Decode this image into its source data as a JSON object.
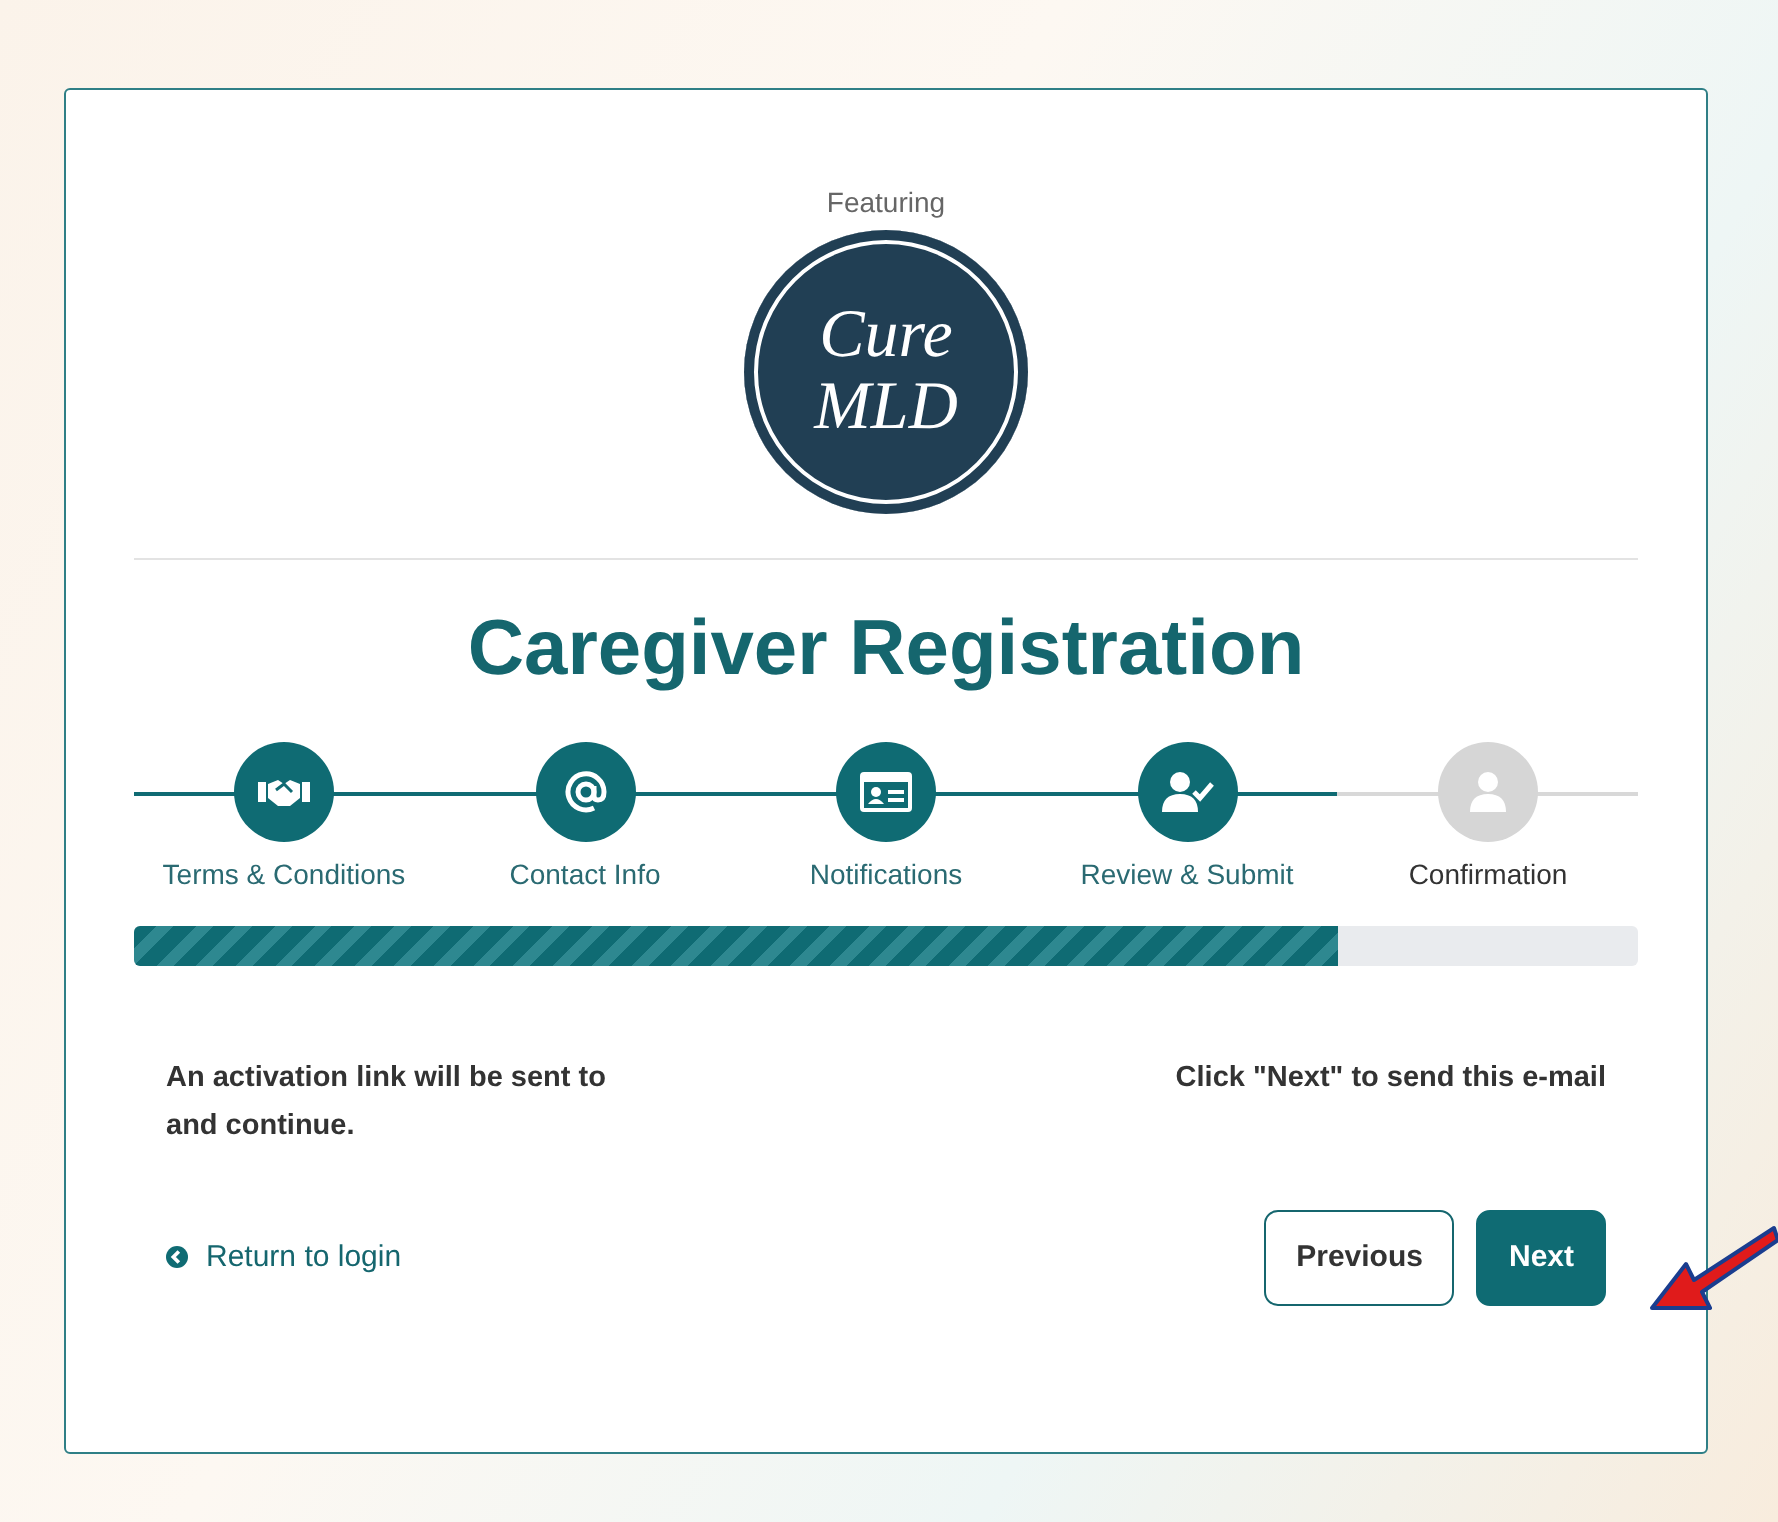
{
  "logo": {
    "caption": "Featuring",
    "line_1": "Cure",
    "line_2": "MLD"
  },
  "title": "Caregiver Registration",
  "steps": [
    {
      "label": "Terms & Conditions",
      "completed": true
    },
    {
      "label": "Contact Info",
      "completed": true
    },
    {
      "label": "Notifications",
      "completed": true
    },
    {
      "label": "Review & Submit",
      "completed": true
    },
    {
      "label": "Confirmation",
      "completed": false
    }
  ],
  "progress": {
    "level": 0.8
  },
  "message": {
    "before": "An activation link will be sent to",
    "after": "Click \"Next\" to send this e-mail",
    "continuation": "and continue."
  },
  "return_link": "Return to login",
  "buttons": [
    {
      "label": "Previous",
      "kind": "outline"
    },
    {
      "label": "Next",
      "kind": "primary"
    }
  ]
}
